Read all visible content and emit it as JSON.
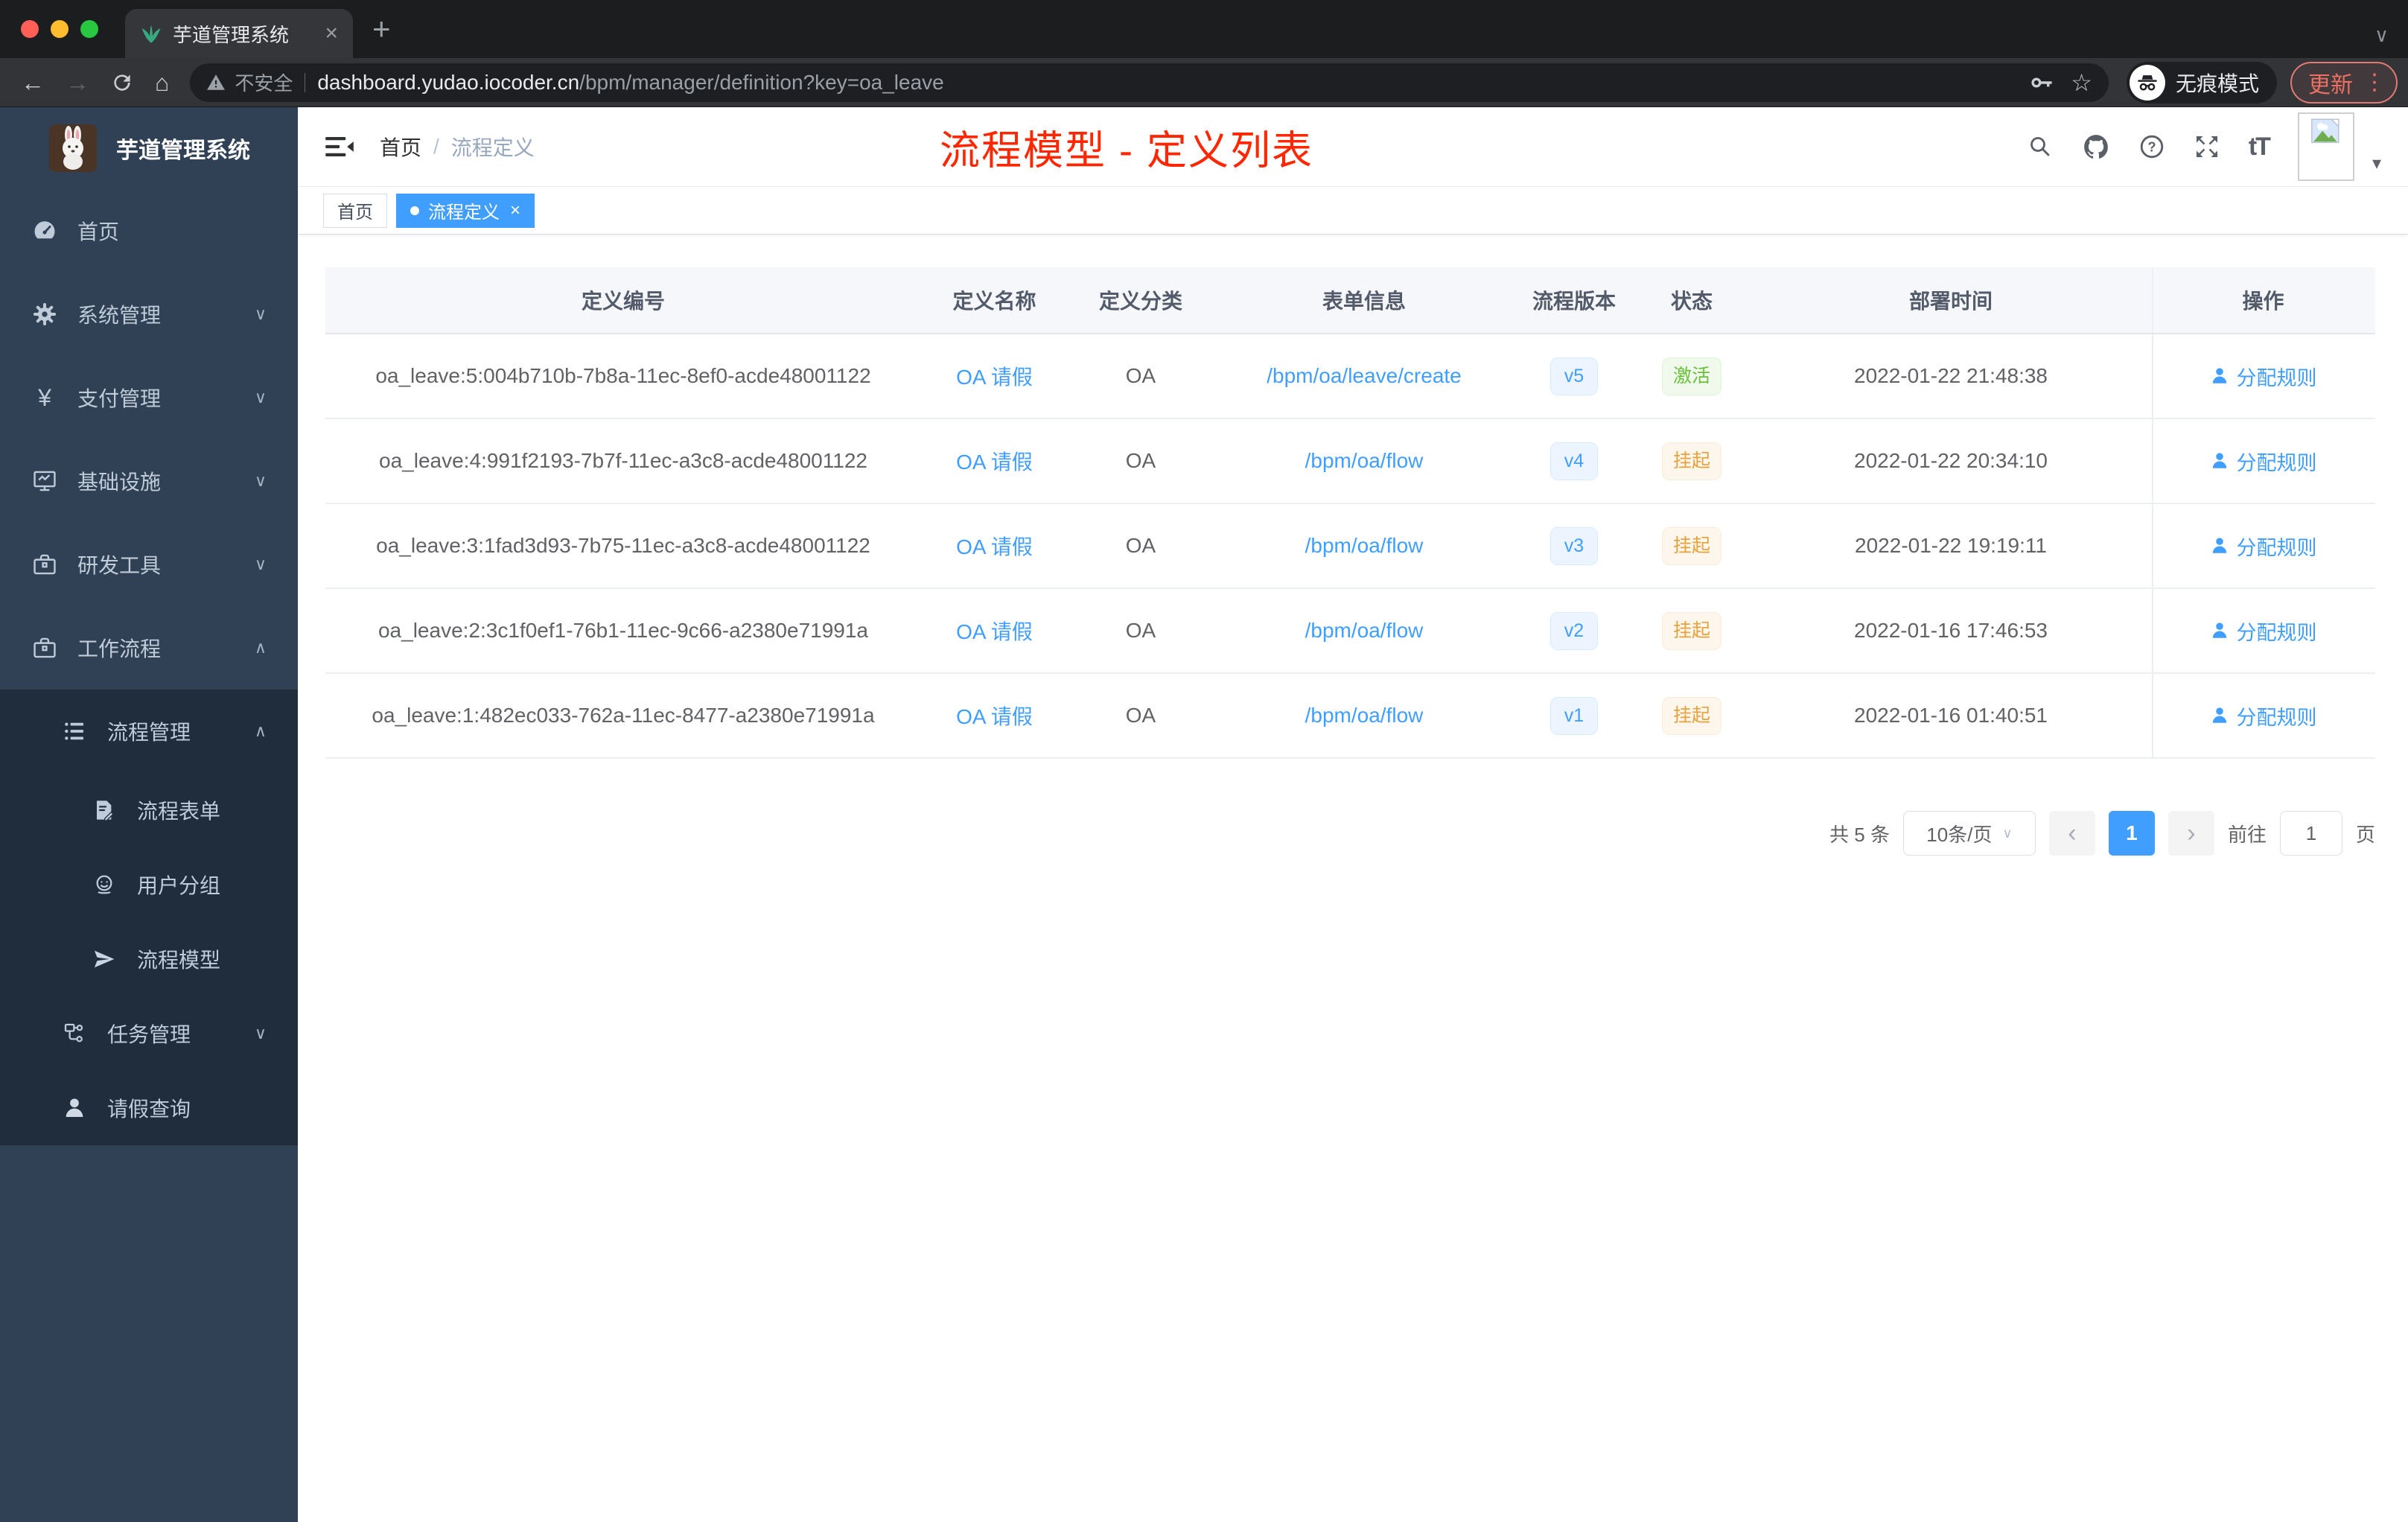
{
  "browser": {
    "tab_title": "芋道管理系统",
    "not_secure_label": "不安全",
    "url_host": "dashboard.yudao.iocoder.cn",
    "url_path": "/bpm/manager/definition?key=oa_leave",
    "incognito_label": "无痕模式",
    "update_label": "更新"
  },
  "icons": {
    "back": "←",
    "forward": "→",
    "home": "⌂",
    "star": "☆",
    "new_tab": "+",
    "tab_close": "×",
    "tag_close": "×",
    "window_chevron": "∨",
    "avatar_caret": "▾",
    "text_size": "tT",
    "more": "⋮",
    "breadcrumb_sep": "/",
    "select_chevron": "∨",
    "prev": "‹",
    "next": "›",
    "yen": "¥"
  },
  "sidebar": {
    "app_title": "芋道管理系统",
    "menu": [
      {
        "label": "首页",
        "icon": "dashboard-icon",
        "arrow": ""
      },
      {
        "label": "系统管理",
        "icon": "gear-icon",
        "arrow": "∨"
      },
      {
        "label": "支付管理",
        "icon": "yen-icon",
        "arrow": "∨"
      },
      {
        "label": "基础设施",
        "icon": "monitor-icon",
        "arrow": "∨"
      },
      {
        "label": "研发工具",
        "icon": "briefcase-icon",
        "arrow": "∨"
      },
      {
        "label": "工作流程",
        "icon": "briefcase-icon",
        "arrow": "∧"
      },
      {
        "label": "流程管理",
        "icon": "list-icon",
        "arrow": "∧"
      },
      {
        "label": "流程表单",
        "icon": "form-icon",
        "arrow": ""
      },
      {
        "label": "用户分组",
        "icon": "user-group-icon",
        "arrow": ""
      },
      {
        "label": "流程模型",
        "icon": "paper-plane-icon",
        "arrow": ""
      },
      {
        "label": "任务管理",
        "icon": "tree-icon",
        "arrow": "∨"
      },
      {
        "label": "请假查询",
        "icon": "person-icon",
        "arrow": ""
      }
    ]
  },
  "header": {
    "breadcrumb_home": "首页",
    "breadcrumb_current": "流程定义",
    "annotation_title": "流程模型 - 定义列表",
    "annotation_color": "#ff2600"
  },
  "tags": [
    {
      "label": "首页",
      "active": false
    },
    {
      "label": "流程定义",
      "active": true
    }
  ],
  "table": {
    "columns": [
      "定义编号",
      "定义名称",
      "定义分类",
      "表单信息",
      "流程版本",
      "状态",
      "部署时间",
      "操作"
    ],
    "rows": [
      {
        "id": "oa_leave:5:004b710b-7b8a-11ec-8ef0-acde48001122",
        "name": "OA 请假",
        "category": "OA",
        "form": "/bpm/oa/leave/create",
        "version": "v5",
        "status": "激活",
        "status_type": "success",
        "deploy_time": "2022-01-22 21:48:38",
        "action": "分配规则"
      },
      {
        "id": "oa_leave:4:991f2193-7b7f-11ec-a3c8-acde48001122",
        "name": "OA 请假",
        "category": "OA",
        "form": "/bpm/oa/flow",
        "version": "v4",
        "status": "挂起",
        "status_type": "warning",
        "deploy_time": "2022-01-22 20:34:10",
        "action": "分配规则"
      },
      {
        "id": "oa_leave:3:1fad3d93-7b75-11ec-a3c8-acde48001122",
        "name": "OA 请假",
        "category": "OA",
        "form": "/bpm/oa/flow",
        "version": "v3",
        "status": "挂起",
        "status_type": "warning",
        "deploy_time": "2022-01-22 19:19:11",
        "action": "分配规则"
      },
      {
        "id": "oa_leave:2:3c1f0ef1-76b1-11ec-9c66-a2380e71991a",
        "name": "OA 请假",
        "category": "OA",
        "form": "/bpm/oa/flow",
        "version": "v2",
        "status": "挂起",
        "status_type": "warning",
        "deploy_time": "2022-01-16 17:46:53",
        "action": "分配规则"
      },
      {
        "id": "oa_leave:1:482ec033-762a-11ec-8477-a2380e71991a",
        "name": "OA 请假",
        "category": "OA",
        "form": "/bpm/oa/flow",
        "version": "v1",
        "status": "挂起",
        "status_type": "warning",
        "deploy_time": "2022-01-16 01:40:51",
        "action": "分配规则"
      }
    ]
  },
  "pagination": {
    "total_label": "共 5 条",
    "page_size": "10条/页",
    "current_page": "1",
    "goto_label": "前往",
    "goto_value": "1",
    "page_unit": "页"
  },
  "colors": {
    "accent": "#409eff",
    "annotation_red": "#ff2600",
    "status_active_green": "#67c23a",
    "status_suspend_orange": "#e6a23c",
    "sidebar_bg": "#304156",
    "submenu_bg": "#1f2d3d"
  }
}
